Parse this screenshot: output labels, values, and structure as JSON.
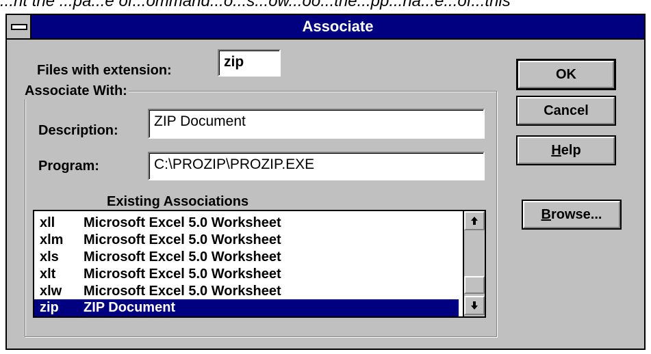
{
  "caption_partial": "...nt the ...pa...e of...ommand...o...s...ow...oo...the...pp...na...e...of...this",
  "window": {
    "title": "Associate"
  },
  "extension": {
    "label": "Files with extension:",
    "value": "zip"
  },
  "group": {
    "label": "Associate With:"
  },
  "description": {
    "label": "Description:",
    "value": "ZIP Document"
  },
  "program": {
    "label": "Program:",
    "value": "C:\\PROZIP\\PROZIP.EXE"
  },
  "existing": {
    "label": "Existing Associations",
    "rows": [
      {
        "ext": "xll",
        "desc": "Microsoft Excel 5.0 Worksheet"
      },
      {
        "ext": "xlm",
        "desc": "Microsoft Excel 5.0 Worksheet"
      },
      {
        "ext": "xls",
        "desc": "Microsoft Excel 5.0 Worksheet"
      },
      {
        "ext": "xlt",
        "desc": "Microsoft Excel 5.0 Worksheet"
      },
      {
        "ext": "xlw",
        "desc": "Microsoft Excel 5.0 Worksheet"
      },
      {
        "ext": "zip",
        "desc": "ZIP Document"
      }
    ],
    "selected_ext": "zip"
  },
  "buttons": {
    "ok": "OK",
    "cancel": "Cancel",
    "help_mnemonic": "H",
    "help_rest": "elp",
    "browse_mnemonic": "B",
    "browse_rest": "rowse..."
  },
  "icons": {
    "system_menu": "system-menu-icon",
    "scroll_up": "scroll-up-arrow-icon",
    "scroll_down": "scroll-down-arrow-icon"
  },
  "colors": {
    "titlebar": "#000080",
    "dialog_face": "#c0c0c0",
    "selection": "#000080"
  }
}
